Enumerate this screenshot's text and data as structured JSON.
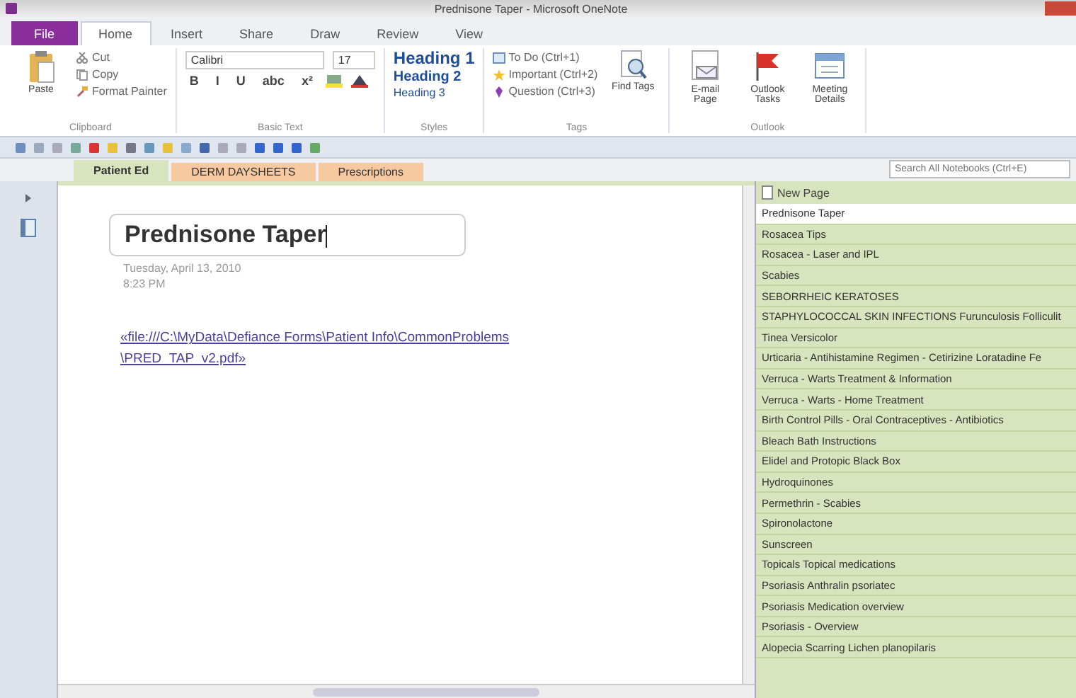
{
  "window": {
    "title": "Prednisone Taper - Microsoft OneNote"
  },
  "ribbon_tabs": [
    {
      "label": "File",
      "kind": "file",
      "selected": false
    },
    {
      "label": "Home",
      "kind": "tab",
      "selected": true
    },
    {
      "label": "Insert",
      "kind": "tab",
      "selected": false
    },
    {
      "label": "Share",
      "kind": "tab",
      "selected": false
    },
    {
      "label": "Draw",
      "kind": "tab",
      "selected": false
    },
    {
      "label": "Review",
      "kind": "tab",
      "selected": false
    },
    {
      "label": "View",
      "kind": "tab",
      "selected": false
    }
  ],
  "clipboard": {
    "paste": "Paste",
    "buttons": [
      {
        "label": "Cut",
        "kind": "cut"
      },
      {
        "label": "Copy",
        "kind": "copy"
      },
      {
        "label": "Format Painter",
        "kind": "painter"
      }
    ],
    "label": "Clipboard"
  },
  "basic_text": {
    "font": "Calibri",
    "size": "17",
    "formats": [
      "B",
      "I",
      "U",
      "abc",
      "x²"
    ],
    "label": "Basic Text"
  },
  "styles": {
    "items": [
      {
        "label": "Heading 1",
        "kind": "h1"
      },
      {
        "label": "Heading 2",
        "kind": "h2"
      },
      {
        "label": "Heading 3",
        "kind": "h3"
      }
    ],
    "label": "Styles"
  },
  "tags": {
    "items": [
      {
        "label": "To Do (Ctrl+1)",
        "kind": "todo"
      },
      {
        "label": "Important (Ctrl+2)",
        "kind": "star"
      },
      {
        "label": "Question (Ctrl+3)",
        "kind": "question"
      }
    ],
    "find": "Find Tags",
    "label": "Tags"
  },
  "outlook": {
    "buttons": [
      {
        "label": "E-mail Page",
        "kind": "mail"
      },
      {
        "label": "Outlook Tasks",
        "kind": "flag"
      },
      {
        "label": "Meeting Details",
        "kind": "meeting"
      }
    ],
    "label": "Outlook"
  },
  "sections": [
    {
      "label": "Patient Ed",
      "color": "#d7e4bd",
      "selected": true
    },
    {
      "label": "DERM DAYSHEETS",
      "color": "#f6c9a0",
      "selected": false
    },
    {
      "label": "Prescriptions",
      "color": "#f6c9a0",
      "selected": false
    }
  ],
  "search": {
    "placeholder": "Search All Notebooks (Ctrl+E)"
  },
  "page": {
    "title": "Prednisone Taper",
    "date": "Tuesday, April 13, 2010",
    "time": "8:23 PM",
    "link_lines": [
      "«file:///C:\\MyData\\Defiance Forms\\Patient Info\\CommonProblems",
      "\\PRED_TAP_v2.pdf»"
    ]
  },
  "page_list": {
    "new_page": "New Page",
    "pages": [
      {
        "title": "Prednisone Taper",
        "selected": true
      },
      {
        "title": "Rosacea Tips",
        "selected": false
      },
      {
        "title": "Rosacea - Laser and IPL",
        "selected": false
      },
      {
        "title": "Scabies",
        "selected": false
      },
      {
        "title": "SEBORRHEIC KERATOSES",
        "selected": false
      },
      {
        "title": "STAPHYLOCOCCAL SKIN INFECTIONS Furunculosis Folliculit",
        "selected": false
      },
      {
        "title": "Tinea Versicolor",
        "selected": false
      },
      {
        "title": "Urticaria - Antihistamine Regimen - Cetirizine Loratadine Fe",
        "selected": false
      },
      {
        "title": "Verruca - Warts Treatment & Information",
        "selected": false
      },
      {
        "title": "Verruca - Warts - Home Treatment",
        "selected": false
      },
      {
        "title": "Birth Control Pills - Oral Contraceptives - Antibiotics",
        "selected": false
      },
      {
        "title": "Bleach Bath Instructions",
        "selected": false
      },
      {
        "title": "Elidel and Protopic Black Box",
        "selected": false
      },
      {
        "title": "Hydroquinones",
        "selected": false
      },
      {
        "title": "Permethrin - Scabies",
        "selected": false
      },
      {
        "title": "Spironolactone",
        "selected": false
      },
      {
        "title": "Sunscreen",
        "selected": false
      },
      {
        "title": "Topicals Topical medications",
        "selected": false
      },
      {
        "title": "Psoriasis Anthralin psoriatec",
        "selected": false
      },
      {
        "title": "Psoriasis Medication overview",
        "selected": false
      },
      {
        "title": "Psoriasis - Overview",
        "selected": false
      },
      {
        "title": "Alopecia Scarring Lichen planopilaris",
        "selected": false
      }
    ]
  }
}
